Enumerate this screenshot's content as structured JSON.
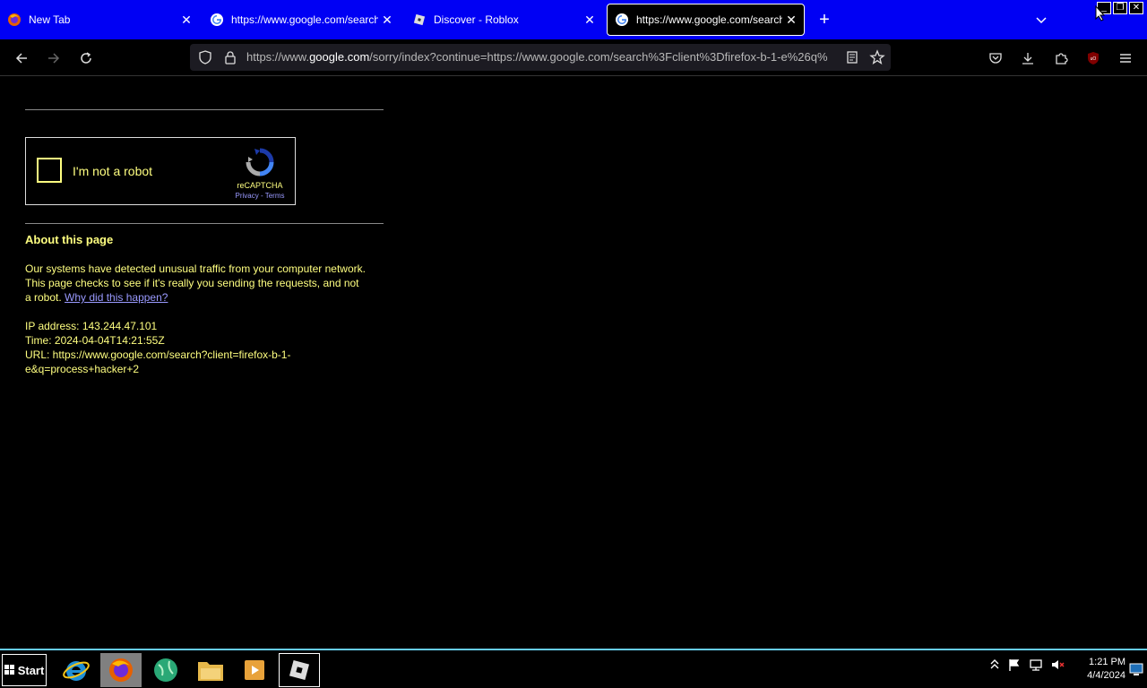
{
  "tabs": [
    {
      "title": "New Tab",
      "icon": "firefox-icon"
    },
    {
      "title": "https://www.google.com/search?c",
      "icon": "google-icon"
    },
    {
      "title": "Discover - Roblox",
      "icon": "roblox-icon"
    },
    {
      "title": "https://www.google.com/search?c",
      "icon": "google-icon",
      "active": true
    }
  ],
  "address_bar": {
    "prefix": "https://www.",
    "host": "google.com",
    "rest": "/sorry/index?continue=https://www.google.com/search%3Fclient%3Dfirefox-b-1-e%26q%"
  },
  "captcha": {
    "label": "I'm not a robot",
    "brand": "reCAPTCHA",
    "privacy": "Privacy",
    "separator": " - ",
    "terms": "Terms"
  },
  "about": {
    "heading": "About this page",
    "paragraph": "Our systems have detected unusual traffic from your computer network. This page checks to see if it's really you sending the requests, and not a robot. ",
    "link": "Why did this happen?",
    "ip": "IP address: 143.244.47.101",
    "time": "Time: 2024-04-04T14:21:55Z",
    "url": "URL: https://www.google.com/search?client=firefox-b-1-e&q=process+hacker+2"
  },
  "taskbar": {
    "start": "Start",
    "time": "1:21 PM",
    "date": "4/4/2024"
  },
  "colors": {
    "tabstrip": "#0000f4",
    "page_text": "#ffff80",
    "link": "#9a9aff"
  }
}
